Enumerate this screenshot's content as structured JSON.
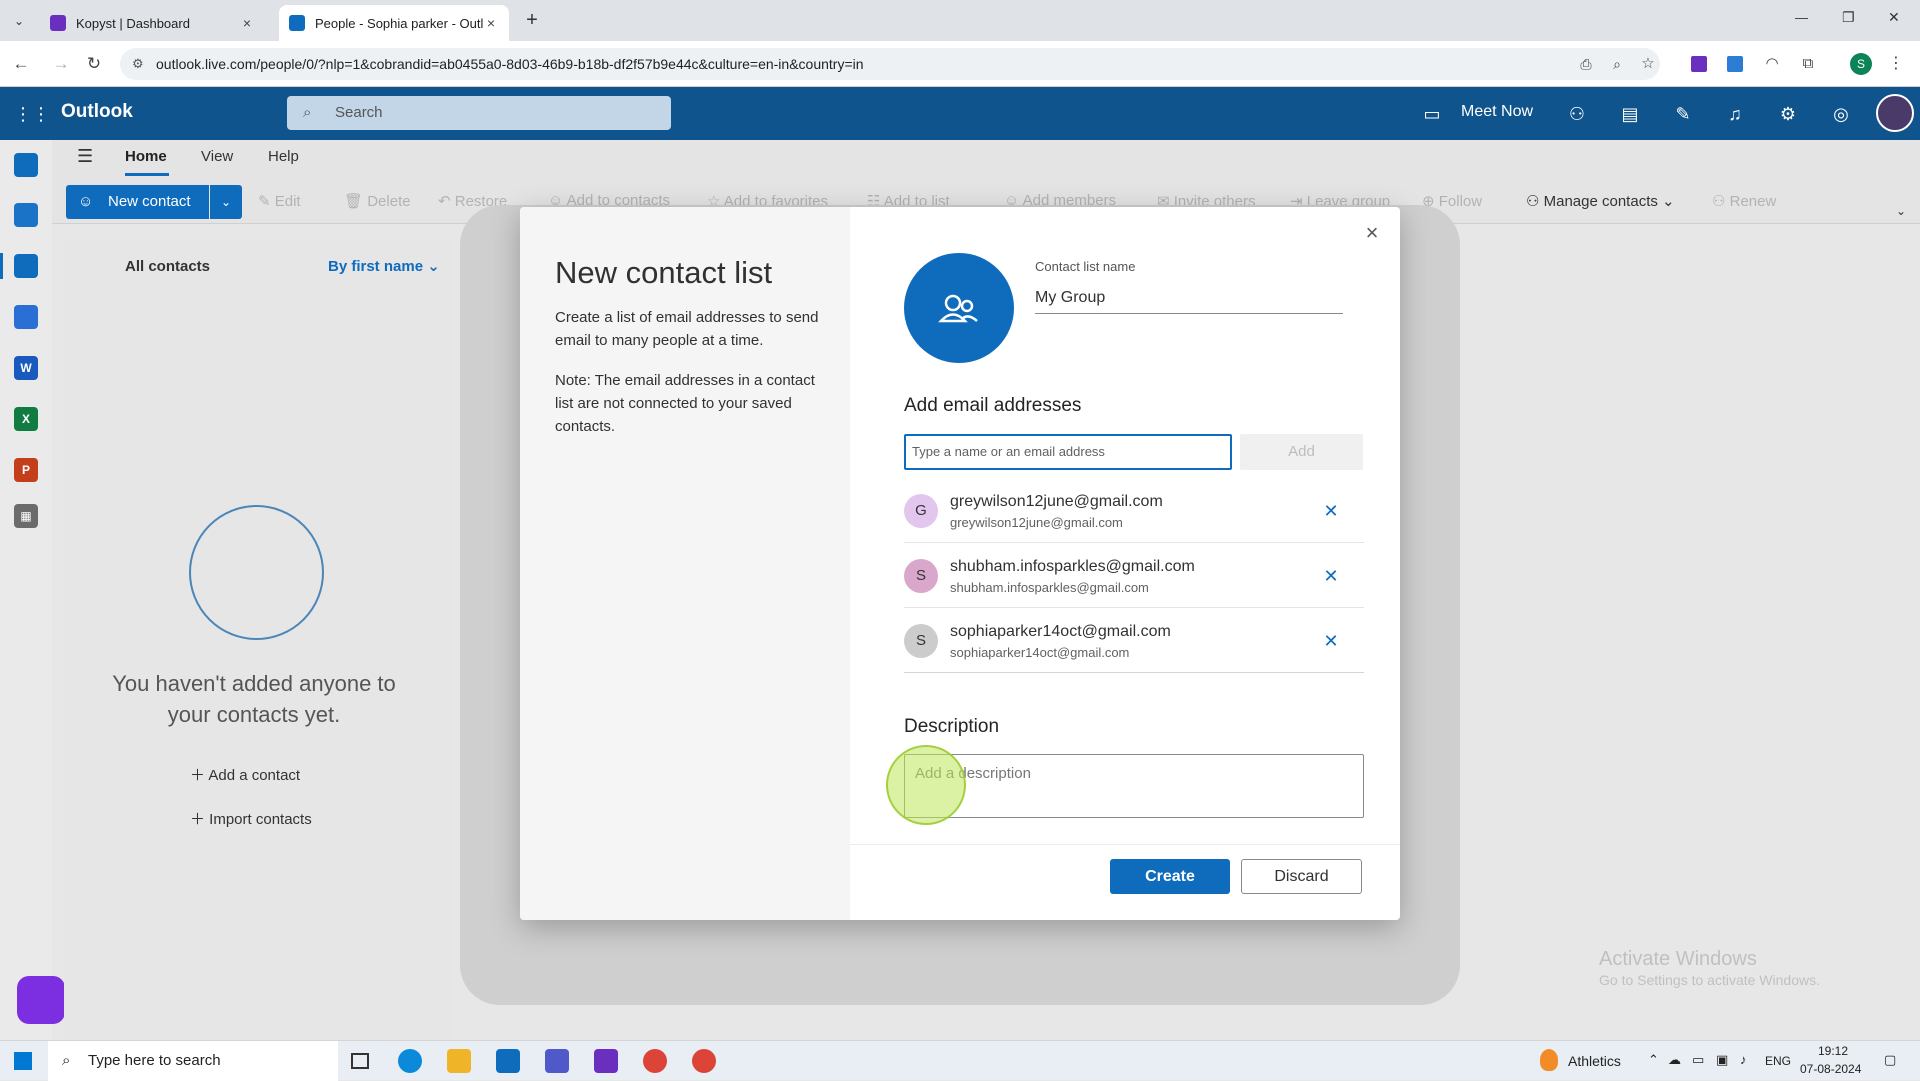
{
  "browser": {
    "tabs": [
      {
        "title": "Kopyst | Dashboard",
        "close": "×"
      },
      {
        "title": "People - Sophia parker - Outlo",
        "close": "×"
      }
    ],
    "new_tab": "+",
    "url": "outlook.live.com/people/0/?nlp=1&cobrandid=ab0455a0-8d03-46b9-b18b-df2f57b9e44c&culture=en-in&country=in",
    "profile_initial": "S",
    "window_controls": [
      "—",
      "❐",
      "✕"
    ]
  },
  "outlook": {
    "app_name": "Outlook",
    "search_placeholder": "Search",
    "meet_now": "Meet Now",
    "ribbon_tabs": [
      "Home",
      "View",
      "Help"
    ],
    "ribbon": {
      "new_contact": "New contact",
      "edit": "Edit",
      "delete": "Delete",
      "restore": "Restore",
      "add_to_contacts": "Add to contacts",
      "add_to_favorites": "Add to favorites",
      "add_to_list": "Add to list",
      "add_members": "Add members",
      "invite_others": "Invite others",
      "leave_group": "Leave group",
      "follow": "Follow",
      "manage_contacts": "Manage contacts",
      "renew": "Renew"
    },
    "contacts_pane": {
      "all_contacts": "All contacts",
      "sort": "By first name",
      "empty_message": "You haven't added anyone to your contacts yet.",
      "add_contact": "Add a contact",
      "import_contacts": "Import contacts"
    }
  },
  "dialog": {
    "title": "New contact list",
    "intro": "Create a list of email addresses to send email to many people at a time.",
    "note": "Note: The email addresses in a contact list are not connected to your saved contacts.",
    "list_name_label": "Contact list name",
    "list_name_value": "My Group",
    "add_emails_heading": "Add email addresses",
    "email_placeholder": "Type a name or an email address",
    "add_button": "Add",
    "members": [
      {
        "initial": "G",
        "name": "greywilson12june@gmail.com",
        "email": "greywilson12june@gmail.com",
        "color": "#e3c6ee"
      },
      {
        "initial": "S",
        "name": "shubham.infosparkles@gmail.com",
        "email": "shubham.infosparkles@gmail.com",
        "color": "#d9a6cc"
      },
      {
        "initial": "S",
        "name": "sophiaparker14oct@gmail.com",
        "email": "sophiaparker14oct@gmail.com",
        "color": "#cccccc"
      }
    ],
    "description_heading": "Description",
    "description_placeholder": "Add a description",
    "create_button": "Create",
    "discard_button": "Discard"
  },
  "watermark": {
    "line1": "Activate Windows",
    "line2": "Go to Settings to activate Windows."
  },
  "taskbar": {
    "search_placeholder": "Type here to search",
    "weather": "Athletics",
    "language": "ENG",
    "time": "19:12",
    "date": "07-08-2024"
  },
  "colors": {
    "outlook_blue": "#0f548c",
    "accent": "#0f6cbd"
  }
}
